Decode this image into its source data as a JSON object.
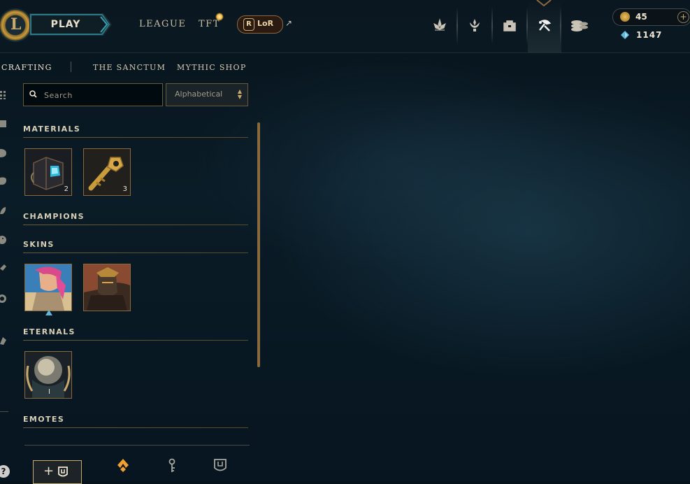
{
  "topbar": {
    "logo_letter": "L",
    "play_label": "PLAY",
    "nav": [
      {
        "label": "LEAGUE"
      },
      {
        "label": "TFT"
      }
    ],
    "lor_label": "LoR",
    "lor_mark": "R",
    "external_glyph": "↗",
    "icons": [
      {
        "name": "clash-icon"
      },
      {
        "name": "events-icon"
      },
      {
        "name": "collection-icon"
      },
      {
        "name": "loot-icon"
      },
      {
        "name": "store-icon"
      }
    ],
    "active_icon": "loot-icon"
  },
  "currency": {
    "rp": "45",
    "blue_essence": "1147",
    "plus_glyph": "+"
  },
  "subnav": {
    "items": [
      {
        "label": "CRAFTING"
      },
      {
        "label": "THE SANCTUM"
      },
      {
        "label": "MYTHIC SHOP"
      }
    ]
  },
  "filters": {
    "search_placeholder": "Search",
    "sort_value": "Alphabetical"
  },
  "categories": {
    "materials": {
      "title": "MATERIALS",
      "items": [
        {
          "name": "hextech-chest",
          "count": "2"
        },
        {
          "name": "hextech-key",
          "count": "3"
        }
      ]
    },
    "champions": {
      "title": "CHAMPIONS"
    },
    "skins": {
      "title": "SKINS",
      "items": [
        {
          "name": "skin-shard-1",
          "owned_marker": true
        },
        {
          "name": "skin-shard-2",
          "owned_marker": false
        }
      ]
    },
    "eternals": {
      "title": "ETERNALS",
      "items": [
        {
          "name": "eternal-series-1",
          "count": "I"
        }
      ]
    },
    "emotes": {
      "title": "EMOTES"
    }
  },
  "footer": {
    "add_slot_plus": "+",
    "help_glyph": "?"
  },
  "colors": {
    "gold": "#c8aa6e",
    "accent_blue": "#5fb6d6",
    "background": "#0a1c27"
  }
}
